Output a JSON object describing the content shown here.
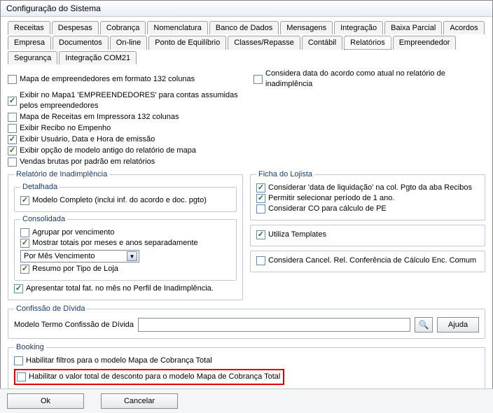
{
  "title": "Configuração do Sistema",
  "tabsRow1": [
    "Receitas",
    "Despesas",
    "Cobrança",
    "Nomenclatura",
    "Banco de Dados",
    "Mensagens",
    "Integração",
    "Baixa Parcial",
    "Acordos",
    "Empresa"
  ],
  "tabsRow2": [
    "Documentos",
    "On-line",
    "Ponto de Equilíbrio",
    "Classes/Repasse",
    "Contábil",
    "Relatórios",
    "Empreendedor",
    "Segurança",
    "Integração COM21"
  ],
  "activeTab": "Relatórios",
  "topChecks": [
    {
      "label": "Mapa de empreendedores em formato 132 colunas",
      "checked": false
    },
    {
      "label": "Exibir no Mapa1 'EMPREENDEDORES' para contas assumidas pelos empreendedores",
      "checked": true
    },
    {
      "label": "Mapa de Receitas em Impressora 132 colunas",
      "checked": false
    },
    {
      "label": "Exibir Recibo no Empenho",
      "checked": false
    },
    {
      "label": "Exibir Usuário, Data e Hora de emissão",
      "checked": true
    },
    {
      "label": "Exibir opção de modelo antigo do relatório de mapa",
      "checked": true
    },
    {
      "label": "Vendas brutas por padrão em relatórios",
      "checked": false
    }
  ],
  "topRight": {
    "label": "Considera data do acordo como atual no relatório de inadimplência",
    "checked": false
  },
  "inad": {
    "legend": "Relatório de Inadimplência",
    "detalhada": {
      "legend": "Detalhada",
      "item": {
        "label": "Modelo Completo (inclui inf. do acordo e doc. pgto)",
        "checked": true
      }
    },
    "consolidada": {
      "legend": "Consolidada",
      "items": [
        {
          "label": "Agrupar por vencimento",
          "checked": false
        },
        {
          "label": "Mostrar totais por meses e anos separadamente",
          "checked": true
        }
      ],
      "select": "Por Mês Vencimento",
      "resumo": {
        "label": "Resumo por Tipo de Loja",
        "checked": true
      }
    },
    "footer": {
      "label": "Apresentar total fat. no mês no Perfil de Inadimplência.",
      "checked": true
    }
  },
  "lojista": {
    "legend": "Ficha do Lojista",
    "items": [
      {
        "label": "Considerar 'data de liquidação' na col. Pgto da aba Recibos",
        "checked": true
      },
      {
        "label": "Permitir selecionar período de 1 ano.",
        "checked": true
      },
      {
        "label": "Considerar CO para cálculo de PE",
        "checked": false
      }
    ]
  },
  "utilizaTemplates": {
    "label": "Utiliza Templates",
    "checked": true
  },
  "consideraCancel": {
    "label": "Considera Cancel. Rel. Conferência de Cálculo Enc. Comum",
    "checked": false
  },
  "confissao": {
    "legend": "Confissão de Dívida",
    "label": "Modelo Termo Confissão de Dívida",
    "ajuda": "Ajuda"
  },
  "booking": {
    "legend": "Booking",
    "items": [
      {
        "label": "Habilitar filtros para o modelo Mapa de Cobrança Total",
        "checked": false
      },
      {
        "label": "Habilitar o valor total de desconto para o modelo Mapa de Cobrança Total",
        "checked": false,
        "highlight": true
      }
    ]
  },
  "buttons": {
    "ok": "Ok",
    "cancel": "Cancelar"
  }
}
